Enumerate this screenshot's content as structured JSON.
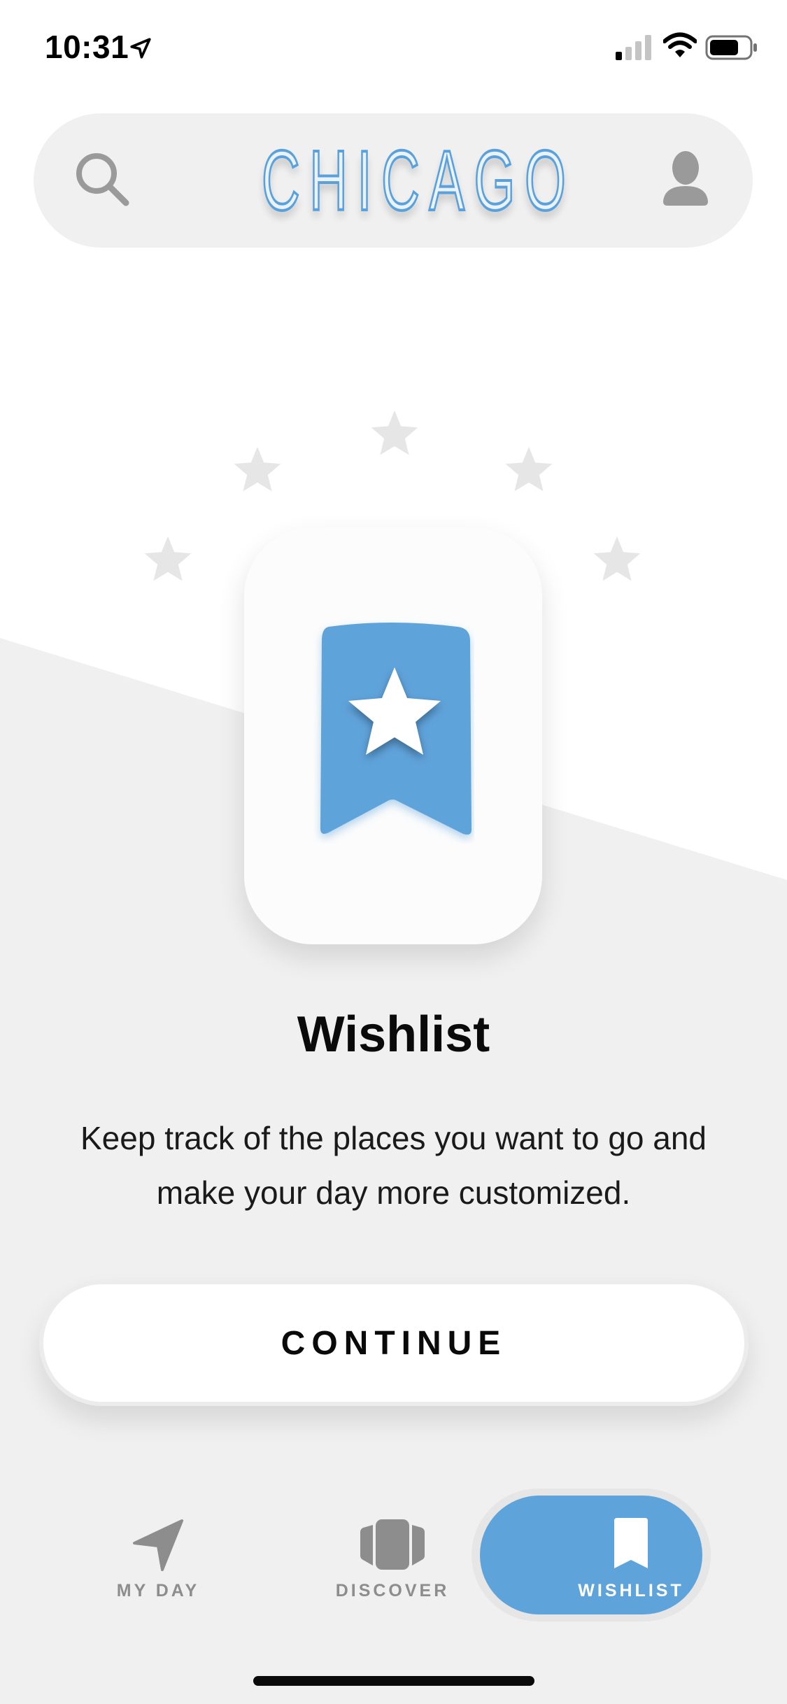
{
  "status_bar": {
    "time": "10:31",
    "icons": [
      "location-arrow-icon",
      "cellular-signal-icon",
      "wifi-icon",
      "battery-icon"
    ]
  },
  "header": {
    "city": "CHICAGO",
    "search_icon": "search-icon",
    "profile_icon": "profile-icon"
  },
  "onboarding": {
    "title": "Wishlist",
    "description": "Keep track of the places you want to go and make your day more customized.",
    "illustration_icon": "bookmark-star-icon",
    "continue_label": "CONTINUE"
  },
  "tabs": [
    {
      "label": "MY DAY",
      "icon": "navigation-arrow-icon",
      "active": false
    },
    {
      "label": "DISCOVER",
      "icon": "cards-icon",
      "active": false
    },
    {
      "label": "WISHLIST",
      "icon": "bookmark-icon",
      "active": true
    }
  ],
  "colors": {
    "accent": "#5fa3db",
    "background_gray": "#f0f0f0",
    "inactive_tab": "#8d8d8d",
    "star_gray": "#e6e6e6"
  }
}
